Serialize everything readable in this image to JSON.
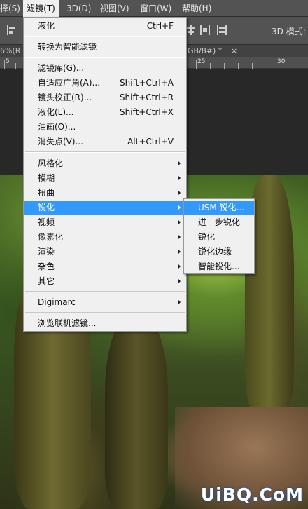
{
  "menubar": {
    "items": [
      {
        "label": "择(S)"
      },
      {
        "label": "滤镜(T)"
      },
      {
        "label": "3D(D)"
      },
      {
        "label": "视图(V)"
      },
      {
        "label": "窗口(W)"
      },
      {
        "label": "帮助(H)"
      }
    ]
  },
  "options_bar": {
    "mode_label": "3D 模式:",
    "icons": [
      "align-left-icon",
      "align-hcenter-icon",
      "align-right-icon",
      "distribute-icon",
      "align-top-icon",
      "align-vcenter-icon",
      "align-bottom-icon",
      "distribute-vertical-icon"
    ]
  },
  "doc_tabs": {
    "left_tab": "6%(R",
    "right_tab": "GB/8#) *",
    "close": "×"
  },
  "ruler": {
    "numbers": [
      "5",
      "25",
      "30"
    ]
  },
  "filter_menu": {
    "items": [
      {
        "label": "液化",
        "shortcut": "Ctrl+F"
      },
      {
        "label": "转换为智能滤镜"
      },
      {
        "label": "滤镜库(G)..."
      },
      {
        "label": "自适应广角(A)...",
        "shortcut": "Shift+Ctrl+A"
      },
      {
        "label": "镜头校正(R)...",
        "shortcut": "Shift+Ctrl+R"
      },
      {
        "label": "液化(L)...",
        "shortcut": "Shift+Ctrl+X"
      },
      {
        "label": "油画(O)..."
      },
      {
        "label": "消失点(V)...",
        "shortcut": "Alt+Ctrl+V"
      },
      {
        "label": "风格化"
      },
      {
        "label": "模糊"
      },
      {
        "label": "扭曲"
      },
      {
        "label": "锐化"
      },
      {
        "label": "视频"
      },
      {
        "label": "像素化"
      },
      {
        "label": "渲染"
      },
      {
        "label": "杂色"
      },
      {
        "label": "其它"
      },
      {
        "label": "Digimarc"
      },
      {
        "label": "浏览联机滤镜..."
      }
    ]
  },
  "sharpen_submenu": {
    "items": [
      {
        "label": "USM 锐化..."
      },
      {
        "label": "进一步锐化"
      },
      {
        "label": "锐化"
      },
      {
        "label": "锐化边缘"
      },
      {
        "label": "智能锐化..."
      }
    ]
  },
  "watermark": "UiBQ.CoM",
  "colors": {
    "highlight": "#3399ff",
    "menu_bg": "#f0f0f0",
    "chrome": "#535353"
  }
}
